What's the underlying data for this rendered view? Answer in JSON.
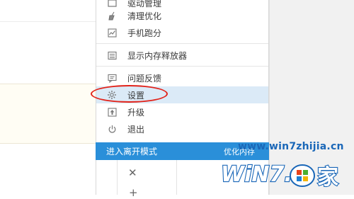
{
  "menu": {
    "items": [
      {
        "label": "驱动管理",
        "icon": "driver-icon",
        "selected": false
      },
      {
        "label": "清理优化",
        "icon": "broom-icon",
        "selected": false
      },
      {
        "label": "手机跑分",
        "icon": "chart-icon",
        "selected": false
      },
      {
        "label": "显示内存释放器",
        "icon": "memory-icon",
        "selected": false
      },
      {
        "label": "问题反馈",
        "icon": "chat-icon",
        "selected": false
      },
      {
        "label": "设置",
        "icon": "gear-icon",
        "selected": true
      },
      {
        "label": "升级",
        "icon": "upgrade-icon",
        "selected": false
      },
      {
        "label": "退出",
        "icon": "power-icon",
        "selected": false
      }
    ],
    "highlight_color": "#e2231a",
    "selected_bg": "#dbeaf7"
  },
  "bottom_bar": {
    "left_label": "进入离开模式",
    "right_label": "优化内存",
    "color": "#2a8fd9"
  },
  "below_panel": {
    "close_symbol": "✕",
    "add_symbol": "+"
  },
  "watermark": {
    "url": "www.win7zhijia.cn",
    "logo_text": "WiN7.",
    "logo_suffix": "家"
  }
}
